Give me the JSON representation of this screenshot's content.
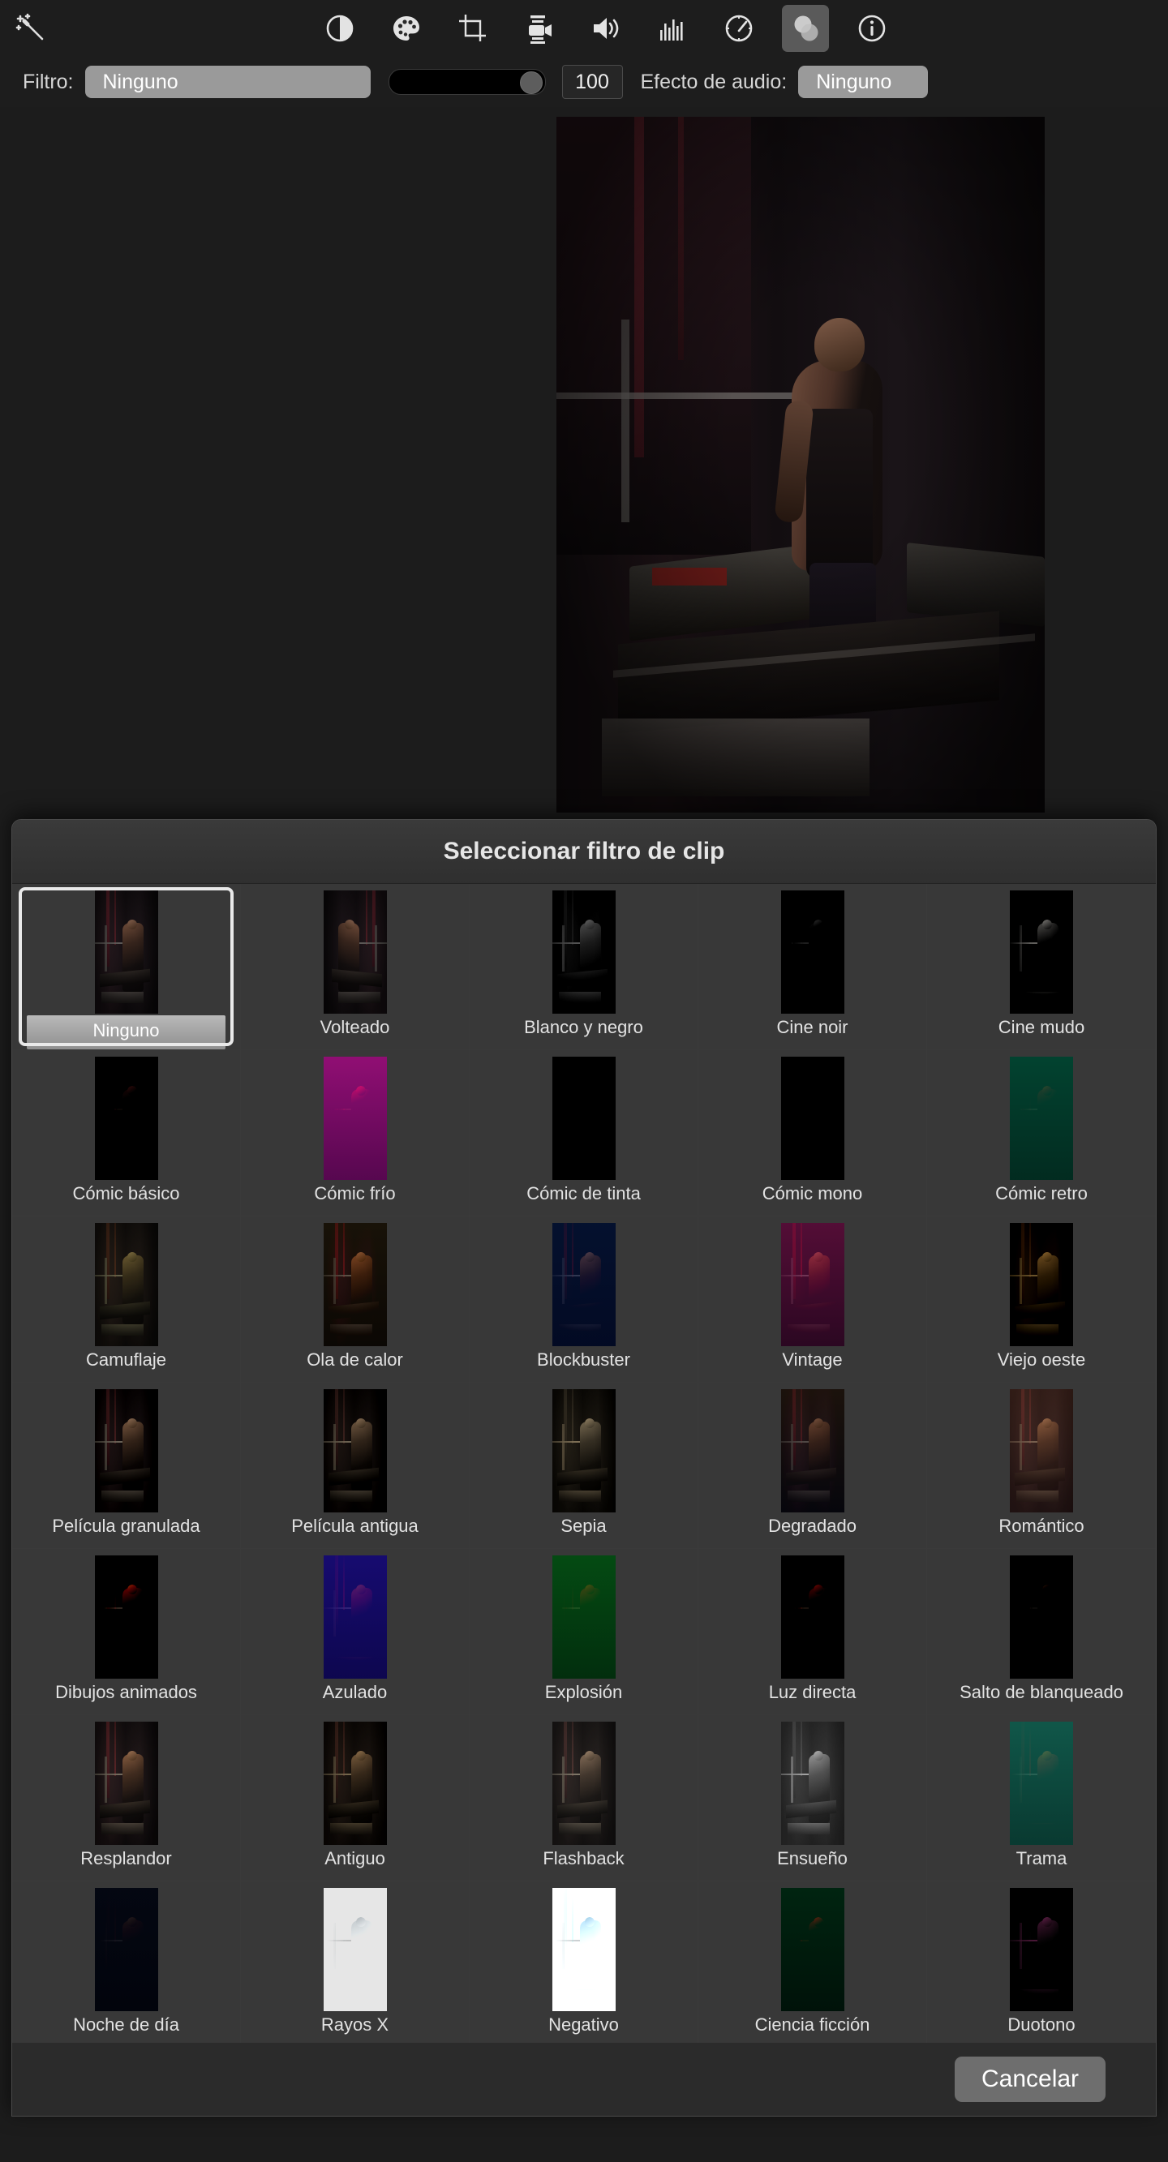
{
  "toolbar": {
    "icons": [
      {
        "name": "magic-wand-icon",
        "label": "Mejorar",
        "active": false
      },
      {
        "name": "color-balance-icon",
        "label": "Balance de color",
        "active": false
      },
      {
        "name": "color-correction-icon",
        "label": "Corrección de color",
        "active": false
      },
      {
        "name": "crop-icon",
        "label": "Recortar",
        "active": false
      },
      {
        "name": "stabilization-icon",
        "label": "Estabilización",
        "active": false
      },
      {
        "name": "volume-icon",
        "label": "Volumen",
        "active": false
      },
      {
        "name": "noise-reduction-icon",
        "label": "Reducción de ruido",
        "active": false
      },
      {
        "name": "speed-icon",
        "label": "Velocidad",
        "active": false
      },
      {
        "name": "clip-filter-icon",
        "label": "Filtro de clip y efecto de audio",
        "active": true
      },
      {
        "name": "info-icon",
        "label": "Información",
        "active": false
      }
    ]
  },
  "filter_bar": {
    "filter_label": "Filtro:",
    "filter_value": "Ninguno",
    "intensity_value": "100",
    "audio_label": "Efecto de audio:",
    "audio_value": "Ninguno"
  },
  "dialog": {
    "title": "Seleccionar filtro de clip",
    "cancel_label": "Cancelar",
    "selected_index": 0,
    "filters": [
      {
        "label": "Ninguno",
        "tint": "none"
      },
      {
        "label": "Volteado",
        "tint": "flip"
      },
      {
        "label": "Blanco y negro",
        "tint": "bw"
      },
      {
        "label": "Cine noir",
        "tint": "noir"
      },
      {
        "label": "Cine mudo",
        "tint": "silent"
      },
      {
        "label": "Cómic básico",
        "tint": "comic-basic"
      },
      {
        "label": "Cómic frío",
        "tint": "comic-cool"
      },
      {
        "label": "Cómic de tinta",
        "tint": "comic-ink"
      },
      {
        "label": "Cómic mono",
        "tint": "comic-mono"
      },
      {
        "label": "Cómic retro",
        "tint": "comic-retro"
      },
      {
        "label": "Camuflaje",
        "tint": "camo"
      },
      {
        "label": "Ola de calor",
        "tint": "heatwave"
      },
      {
        "label": "Blockbuster",
        "tint": "blockbuster"
      },
      {
        "label": "Vintage",
        "tint": "vintage"
      },
      {
        "label": "Viejo oeste",
        "tint": "western"
      },
      {
        "label": "Película granulada",
        "tint": "grain"
      },
      {
        "label": "Película antigua",
        "tint": "oldfilm"
      },
      {
        "label": "Sepia",
        "tint": "sepia"
      },
      {
        "label": "Degradado",
        "tint": "gradient"
      },
      {
        "label": "Romántico",
        "tint": "romantic"
      },
      {
        "label": "Dibujos animados",
        "tint": "cartoon"
      },
      {
        "label": "Azulado",
        "tint": "bluish"
      },
      {
        "label": "Explosión",
        "tint": "explosion"
      },
      {
        "label": "Luz directa",
        "tint": "hardlight"
      },
      {
        "label": "Salto de blanqueado",
        "tint": "bleach"
      },
      {
        "label": "Resplandor",
        "tint": "glow"
      },
      {
        "label": "Antiguo",
        "tint": "aged"
      },
      {
        "label": "Flashback",
        "tint": "flashback"
      },
      {
        "label": "Ensueño",
        "tint": "dream"
      },
      {
        "label": "Trama",
        "tint": "halftone"
      },
      {
        "label": "Noche de día",
        "tint": "daynight"
      },
      {
        "label": "Rayos X",
        "tint": "xray"
      },
      {
        "label": "Negativo",
        "tint": "negative"
      },
      {
        "label": "Ciencia ficción",
        "tint": "scifi"
      },
      {
        "label": "Duotono",
        "tint": "duotone"
      }
    ]
  },
  "colors": {
    "window_bg": "#1c1c1c",
    "dialog_bg": "#2b2b2b",
    "cell_bg": "#383838",
    "popup_bg": "#9a9a9a",
    "selection_ring": "#e9e9e9",
    "cancel_bg": "#6e6e6e",
    "text": "#e2e2e2"
  }
}
